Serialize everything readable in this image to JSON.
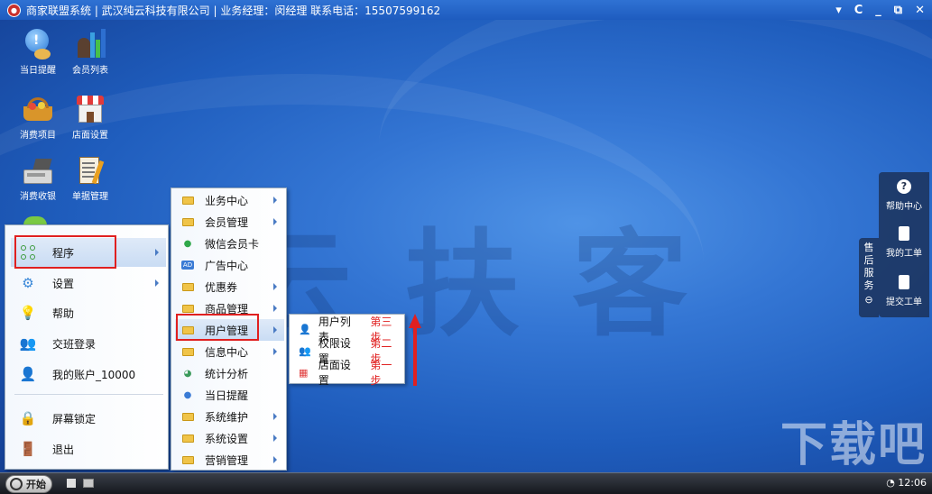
{
  "title": {
    "text": "商家联盟系统 | 武汉纯云科技有限公司 | 业务经理：闵经理 联系电话：15507599162",
    "controls": [
      "▾",
      "C",
      "_",
      "⧉",
      "✕"
    ]
  },
  "desktop_icons": [
    {
      "label": "当日提醒"
    },
    {
      "label": "会员列表"
    },
    {
      "label": "消费项目"
    },
    {
      "label": "店面设置"
    },
    {
      "label": "消费收银"
    },
    {
      "label": "单据管理"
    }
  ],
  "start_menu": {
    "items": [
      "程序",
      "设置",
      "帮助",
      "交班登录",
      "我的账户_10000",
      "屏幕锁定",
      "退出"
    ]
  },
  "program_menu": {
    "items": [
      "业务中心",
      "会员管理",
      "微信会员卡",
      "广告中心",
      "优惠券",
      "商品管理",
      "用户管理",
      "信息中心",
      "统计分析",
      "当日提醒",
      "系统维护",
      "系统设置",
      "营销管理"
    ]
  },
  "user_submenu": {
    "items": [
      {
        "label": "用户列表",
        "step": "第三步"
      },
      {
        "label": "权限设置",
        "step": "第二步"
      },
      {
        "label": "店面设置",
        "step": "第一步"
      }
    ]
  },
  "right_panel": {
    "side_label": [
      "售",
      "后",
      "服",
      "务"
    ],
    "help": "帮助中心",
    "my_ticket": "我的工单",
    "submit_ticket": "提交工单"
  },
  "taskbar": {
    "start_label": "开始",
    "clock": "12:06"
  },
  "colors": {
    "highlight_red": "#e02020",
    "accent_blue": "#2f72d3"
  }
}
